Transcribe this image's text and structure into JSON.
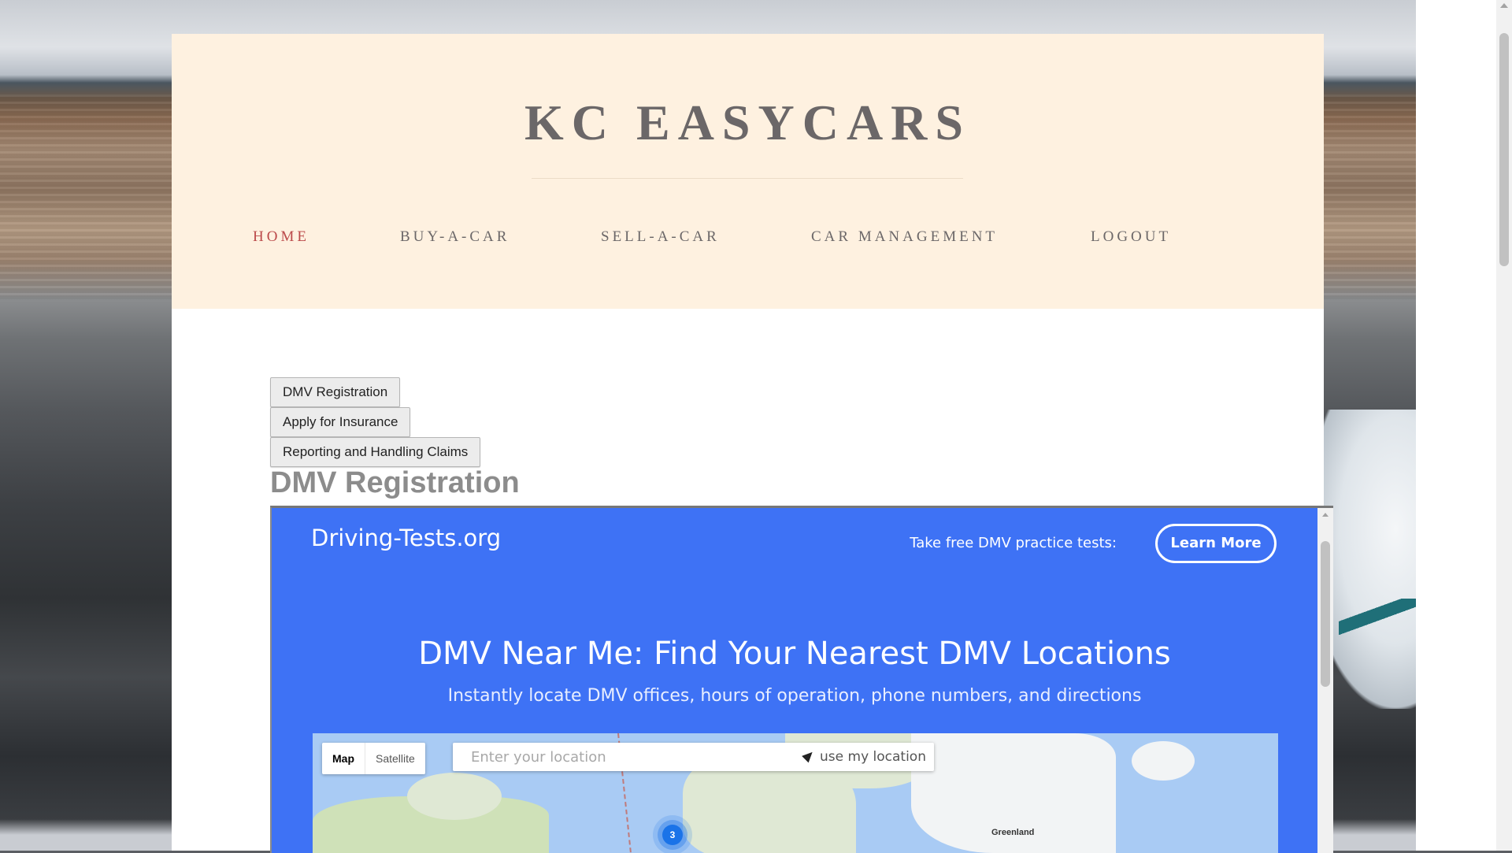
{
  "site": {
    "title": "KC EASYCARS"
  },
  "nav": {
    "items": [
      {
        "label": "HOME",
        "active": true
      },
      {
        "label": "BUY-A-CAR"
      },
      {
        "label": "SELL-A-CAR"
      },
      {
        "label": "CAR MANAGEMENT"
      },
      {
        "label": "LOGOUT"
      }
    ]
  },
  "buttons": {
    "dmv": "DMV Registration",
    "insurance": "Apply for Insurance",
    "claims": "Reporting and Handling Claims"
  },
  "section": {
    "title": "DMV Registration"
  },
  "embed": {
    "brand": "Driving-Tests.org",
    "promo_text": "Take free DMV practice tests:",
    "learn_more": "Learn More",
    "hero_title": "DMV Near Me: Find Your Nearest DMV Locations",
    "hero_subtitle": "Instantly locate DMV offices, hours of operation, phone numbers, and directions",
    "map": {
      "type_map": "Map",
      "type_satellite": "Satellite",
      "location_placeholder": "Enter your location",
      "use_location": "use my location",
      "label_greenland": "Greenland",
      "cluster_count": "3"
    }
  },
  "colors": {
    "header_bg": "#fef1e0",
    "nav_active": "#bb4a4a",
    "nav_text": "#6b6768",
    "embed_bg": "#3e72f5"
  }
}
